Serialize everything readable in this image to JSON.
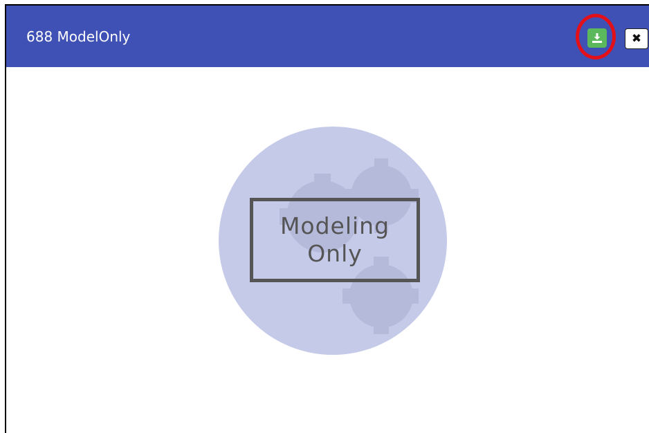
{
  "dialog": {
    "title": "688 ModelOnly",
    "download_icon": "download-icon",
    "close_icon": "close-icon",
    "close_glyph": "✖"
  },
  "placeholder": {
    "line1": "Modeling",
    "line2": "Only",
    "icon": "gears-icon"
  },
  "colors": {
    "titlebar": "#3f51b5",
    "download_button": "#5cb85c",
    "highlight": "#e3101a",
    "placeholder_circle": "#c5cae9",
    "stamp": "#555555"
  }
}
